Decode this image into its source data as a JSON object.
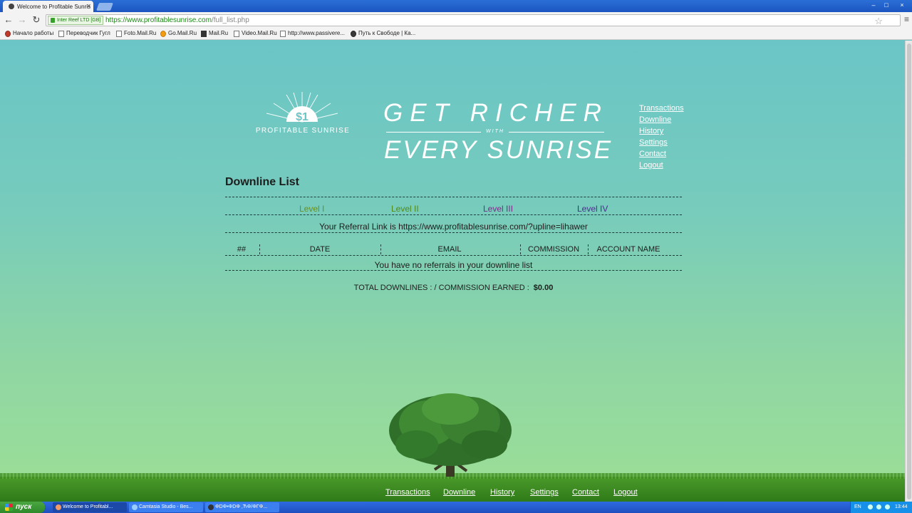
{
  "browser": {
    "tab_title": "Welcome to Profitable Sunris",
    "window_buttons": [
      "–",
      "□",
      "×"
    ],
    "ev_badge": "Inter Reef LTD [GB]",
    "url_host": "https://www.profitablesunrise.com",
    "url_path": "/full_list.php",
    "bookmarks": [
      "Начало работы",
      "Переводчик Гугл",
      "Foto.Mail.Ru",
      "Go.Mail.Ru",
      "Mail.Ru",
      "Video.Mail.Ru",
      "http://www.passivere...",
      "Путь к Свободе | Ка..."
    ]
  },
  "site": {
    "logo_text": "PROFITABLE SUNRISE",
    "logo_symbol": "$1",
    "slogan_top": "GET RICHER",
    "slogan_with": "WITH",
    "slogan_bottom": "EVERY SUNRISE",
    "nav": [
      "Transactions",
      "Downline",
      "History",
      "Settings",
      "Contact",
      "Logout"
    ],
    "nav_color": "#ffffff"
  },
  "downline": {
    "heading": "Downline List",
    "levels": [
      {
        "label": "Level I",
        "color": "#6a8f1c"
      },
      {
        "label": "Level II",
        "color": "#4f8a1a"
      },
      {
        "label": "Level III",
        "color": "#7b2a86"
      },
      {
        "label": "Level IV",
        "color": "#4a2f8a"
      }
    ],
    "referral_link": "Your Referral Link is https://www.profitablesunrise.com/?upline=lihawer",
    "columns": [
      "##",
      "DATE",
      "EMAIL",
      "COMMISSION",
      "ACCOUNT NAME"
    ],
    "empty_message": "You have no referrals in your downline list",
    "totals_label": "TOTAL DOWNLINES :  / COMMISSION EARNED :",
    "totals_value": "$0.00"
  },
  "footer": {
    "nav": [
      "Transactions",
      "Downline",
      "History",
      "Settings",
      "Contact",
      "Logout"
    ]
  },
  "taskbar": {
    "start_label": "пуск",
    "tasks": [
      "Welcome to Profitabl...",
      "Camtasia Studio - Bes...",
      "ΦDΦ•ΦDΦ ,ЋΦ/ΦΓΦ..."
    ],
    "lang": "EN",
    "clock": "13:44"
  }
}
